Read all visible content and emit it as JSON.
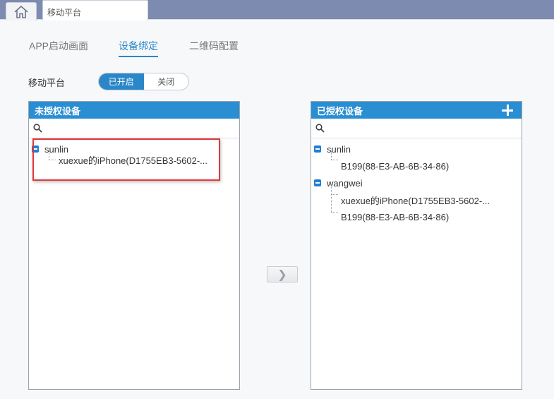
{
  "tab_bar": {
    "page_tab_label": "移动平台"
  },
  "subtabs": [
    {
      "label": "APP启动画面",
      "active": false
    },
    {
      "label": "设备绑定",
      "active": true
    },
    {
      "label": "二维码配置",
      "active": false
    }
  ],
  "platform": {
    "label": "移动平台",
    "toggle_on": "已开启",
    "toggle_off": "关闭",
    "selected": "已开启"
  },
  "left_panel": {
    "title": "未授权设备",
    "search_placeholder": "",
    "tree": [
      {
        "user": "sunlin",
        "devices": [
          "xuexue的iPhone(D1755EB3-5602-..."
        ]
      }
    ]
  },
  "right_panel": {
    "title": "已授权设备",
    "search_placeholder": "",
    "tree": [
      {
        "user": "sunlin",
        "devices": [
          "B199(88-E3-AB-6B-34-86)"
        ]
      },
      {
        "user": "wangwei",
        "devices": [
          "xuexue的iPhone(D1755EB3-5602-...",
          "B199(88-E3-AB-6B-34-86)"
        ]
      }
    ]
  },
  "transfer_button": {
    "label": "❯"
  },
  "icons": {
    "home": "home-icon",
    "search": "search-icon",
    "add": "plus-icon",
    "collapse": "collapse-minus-icon"
  },
  "colors": {
    "accent": "#2b87c8",
    "panel_header": "#2a8ed3",
    "highlight": "#e0393b",
    "top_strip": "#7d8bb0"
  }
}
